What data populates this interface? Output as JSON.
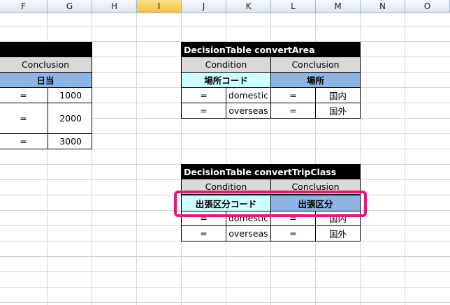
{
  "columns": [
    "F",
    "G",
    "H",
    "I",
    "J",
    "K",
    "L",
    "M",
    "N",
    "O"
  ],
  "selected_column": "I",
  "left_table": {
    "header": "Conclusion",
    "sub": "日当",
    "rows": [
      {
        "op": "=",
        "value": "1000"
      },
      {
        "op": "=",
        "value": "2000"
      },
      {
        "op": "=",
        "value": "3000"
      }
    ]
  },
  "area_table": {
    "title": "DecisionTable convertArea",
    "condition": "Condition",
    "conclusion": "Conclusion",
    "cond_field": "場所コード",
    "concl_field": "場所",
    "rows": [
      {
        "op1": "=",
        "code": "domestic",
        "op2": "=",
        "result": "国内"
      },
      {
        "op1": "=",
        "code": "overseas",
        "op2": "=",
        "result": "国外"
      }
    ]
  },
  "trip_table": {
    "title": "DecisionTable convertTripClass",
    "condition": "Condition",
    "conclusion": "Conclusion",
    "cond_field": "出張区分コード",
    "concl_field": "出張区分",
    "rows": [
      {
        "op1": "=",
        "code": "domestic",
        "op2": "=",
        "result": "国内"
      },
      {
        "op1": "=",
        "code": "overseas",
        "op2": "=",
        "result": "国外"
      }
    ]
  },
  "highlight_color": "#e6187e"
}
